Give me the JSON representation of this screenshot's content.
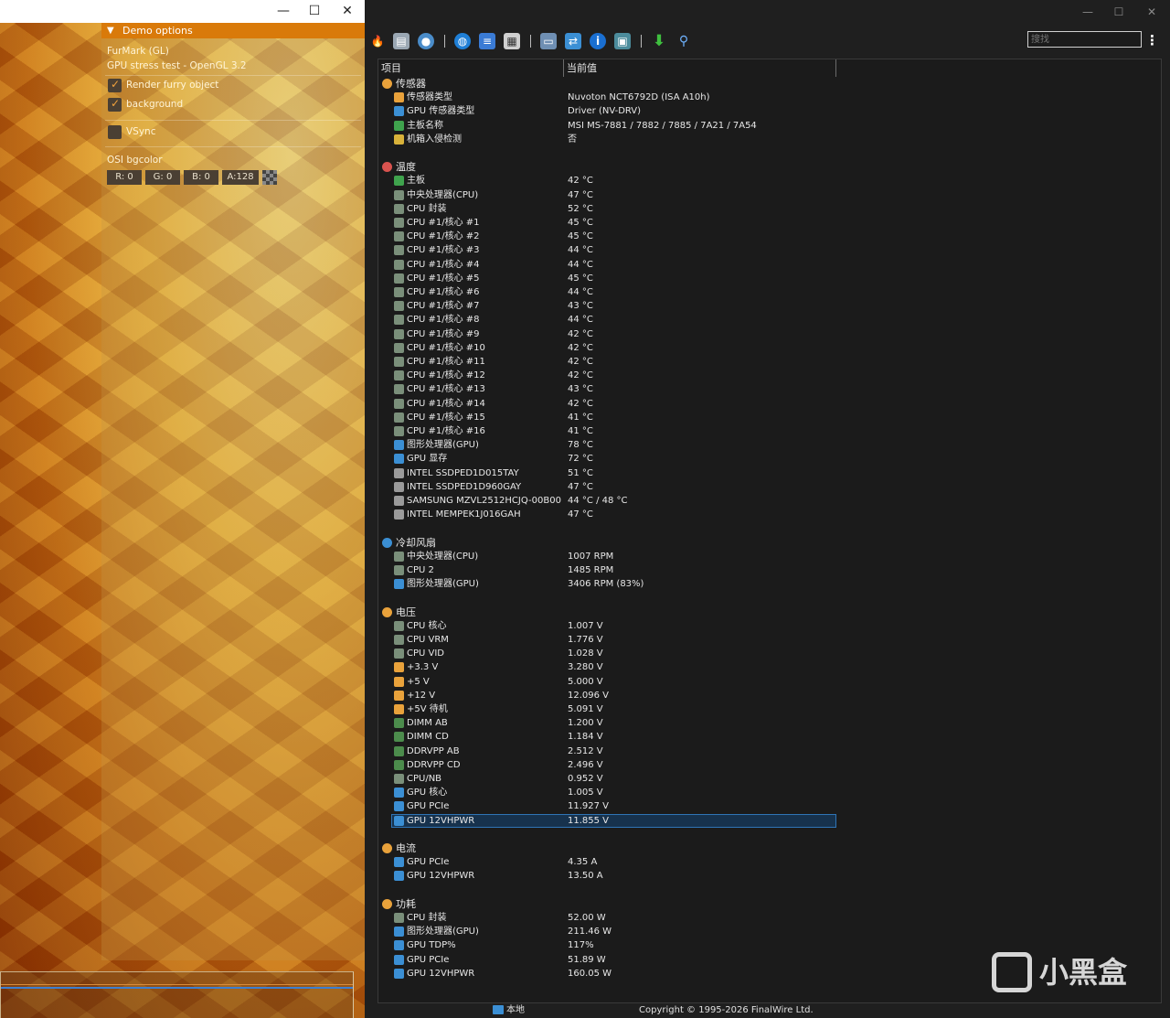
{
  "furmark": {
    "window_controls": [
      "—",
      "☐",
      "✕"
    ],
    "panel_title": "Demo options",
    "app_name": "FurMark (GL)",
    "subtitle": "GPU stress test - OpenGL 3.2",
    "options": [
      {
        "label": "Render furry object",
        "checked": true
      },
      {
        "label": "background",
        "checked": true
      },
      {
        "label": "VSync",
        "checked": false
      }
    ],
    "osi_label": "OSI bgcolor",
    "rgba": [
      "R: 0",
      "G: 0",
      "B: 0",
      "A:128"
    ]
  },
  "aida": {
    "window_controls": [
      "—",
      "☐",
      "✕"
    ],
    "toolbar_icons": [
      "flame-icon",
      "report-icon",
      "user-icon",
      "globe-icon",
      "database-icon",
      "calendar-icon",
      "monitor-icon",
      "network-icon",
      "info-icon",
      "board-icon",
      "download-icon",
      "search-icon"
    ],
    "search_placeholder": "搜找",
    "columns": {
      "item": "项目",
      "value": "当前值"
    },
    "rows": [
      {
        "section": true,
        "label": "传感器",
        "color": "#e9a23b"
      },
      {
        "label": "传感器类型",
        "value": "Nuvoton NCT6792D  (ISA A10h)",
        "color": "#e9a23b"
      },
      {
        "label": "GPU 传感器类型",
        "value": "Driver  (NV-DRV)",
        "color": "#3b8fd4"
      },
      {
        "label": "主板名称",
        "value": "MSI MS-7881 / 7882 / 7885 / 7A21 / 7A54",
        "color": "#3fa34d"
      },
      {
        "label": "机箱入侵检测",
        "value": "否",
        "color": "#d9b23a"
      },
      {
        "blank": true
      },
      {
        "section": true,
        "label": "温度",
        "color": "#d9534f"
      },
      {
        "label": "主板",
        "value": "42 °C",
        "color": "#3fa34d"
      },
      {
        "label": "中央处理器(CPU)",
        "value": "47 °C",
        "color": "#7a8f7a"
      },
      {
        "label": "CPU 封装",
        "value": "52 °C",
        "color": "#7a8f7a"
      },
      {
        "label": "CPU #1/核心 #1",
        "value": "45 °C",
        "color": "#7a8f7a"
      },
      {
        "label": "CPU #1/核心 #2",
        "value": "45 °C",
        "color": "#7a8f7a"
      },
      {
        "label": "CPU #1/核心 #3",
        "value": "44 °C",
        "color": "#7a8f7a"
      },
      {
        "label": "CPU #1/核心 #4",
        "value": "44 °C",
        "color": "#7a8f7a"
      },
      {
        "label": "CPU #1/核心 #5",
        "value": "45 °C",
        "color": "#7a8f7a"
      },
      {
        "label": "CPU #1/核心 #6",
        "value": "44 °C",
        "color": "#7a8f7a"
      },
      {
        "label": "CPU #1/核心 #7",
        "value": "43 °C",
        "color": "#7a8f7a"
      },
      {
        "label": "CPU #1/核心 #8",
        "value": "44 °C",
        "color": "#7a8f7a"
      },
      {
        "label": "CPU #1/核心 #9",
        "value": "42 °C",
        "color": "#7a8f7a"
      },
      {
        "label": "CPU #1/核心 #10",
        "value": "42 °C",
        "color": "#7a8f7a"
      },
      {
        "label": "CPU #1/核心 #11",
        "value": "42 °C",
        "color": "#7a8f7a"
      },
      {
        "label": "CPU #1/核心 #12",
        "value": "42 °C",
        "color": "#7a8f7a"
      },
      {
        "label": "CPU #1/核心 #13",
        "value": "43 °C",
        "color": "#7a8f7a"
      },
      {
        "label": "CPU #1/核心 #14",
        "value": "42 °C",
        "color": "#7a8f7a"
      },
      {
        "label": "CPU #1/核心 #15",
        "value": "41 °C",
        "color": "#7a8f7a"
      },
      {
        "label": "CPU #1/核心 #16",
        "value": "41 °C",
        "color": "#7a8f7a"
      },
      {
        "label": "图形处理器(GPU)",
        "value": "78 °C",
        "color": "#3b8fd4"
      },
      {
        "label": "GPU 显存",
        "value": "72 °C",
        "color": "#3b8fd4"
      },
      {
        "label": "INTEL SSDPED1D015TAY",
        "value": "51 °C",
        "color": "#9a9a9a"
      },
      {
        "label": "INTEL SSDPED1D960GAY",
        "value": "47 °C",
        "color": "#9a9a9a"
      },
      {
        "label": "SAMSUNG MZVL2512HCJQ-00B00",
        "value": "44 °C / 48 °C",
        "color": "#9a9a9a"
      },
      {
        "label": "INTEL MEMPEK1J016GAH",
        "value": "47 °C",
        "color": "#9a9a9a"
      },
      {
        "blank": true
      },
      {
        "section": true,
        "label": "冷却风扇",
        "color": "#3b8fd4"
      },
      {
        "label": "中央处理器(CPU)",
        "value": "1007 RPM",
        "color": "#7a8f7a"
      },
      {
        "label": "CPU 2",
        "value": "1485 RPM",
        "color": "#7a8f7a"
      },
      {
        "label": "图形处理器(GPU)",
        "value": "3406 RPM  (83%)",
        "color": "#3b8fd4"
      },
      {
        "blank": true
      },
      {
        "section": true,
        "label": "电压",
        "color": "#e9a23b"
      },
      {
        "label": "CPU 核心",
        "value": "1.007 V",
        "color": "#7a8f7a"
      },
      {
        "label": "CPU VRM",
        "value": "1.776 V",
        "color": "#7a8f7a"
      },
      {
        "label": "CPU VID",
        "value": "1.028 V",
        "color": "#7a8f7a"
      },
      {
        "label": "+3.3 V",
        "value": "3.280 V",
        "color": "#e9a23b"
      },
      {
        "label": "+5 V",
        "value": "5.000 V",
        "color": "#e9a23b"
      },
      {
        "label": "+12 V",
        "value": "12.096 V",
        "color": "#e9a23b"
      },
      {
        "label": "+5V 待机",
        "value": "5.091 V",
        "color": "#e9a23b"
      },
      {
        "label": "DIMM AB",
        "value": "1.200 V",
        "color": "#4c8c4c"
      },
      {
        "label": "DIMM CD",
        "value": "1.184 V",
        "color": "#4c8c4c"
      },
      {
        "label": "DDRVPP AB",
        "value": "2.512 V",
        "color": "#4c8c4c"
      },
      {
        "label": "DDRVPP CD",
        "value": "2.496 V",
        "color": "#4c8c4c"
      },
      {
        "label": "CPU/NB",
        "value": "0.952 V",
        "color": "#7a8f7a"
      },
      {
        "label": "GPU 核心",
        "value": "1.005 V",
        "color": "#3b8fd4"
      },
      {
        "label": "GPU PCIe",
        "value": "11.927 V",
        "color": "#3b8fd4"
      },
      {
        "label": "GPU 12VHPWR",
        "value": "11.855 V",
        "color": "#3b8fd4",
        "selected": true
      },
      {
        "blank": true
      },
      {
        "section": true,
        "label": "电流",
        "color": "#e9a23b"
      },
      {
        "label": "GPU PCIe",
        "value": "4.35 A",
        "color": "#3b8fd4"
      },
      {
        "label": "GPU 12VHPWR",
        "value": "13.50 A",
        "color": "#3b8fd4"
      },
      {
        "blank": true
      },
      {
        "section": true,
        "label": "功耗",
        "color": "#e9a23b"
      },
      {
        "label": "CPU 封装",
        "value": "52.00 W",
        "color": "#7a8f7a"
      },
      {
        "label": "图形处理器(GPU)",
        "value": "211.46 W",
        "color": "#3b8fd4"
      },
      {
        "label": "GPU TDP%",
        "value": "117%",
        "color": "#3b8fd4"
      },
      {
        "label": "GPU PCIe",
        "value": "51.89 W",
        "color": "#3b8fd4"
      },
      {
        "label": "GPU 12VHPWR",
        "value": "160.05 W",
        "color": "#3b8fd4"
      }
    ],
    "status_left": "本地",
    "status_copyright": "Copyright © 1995-2026 FinalWire Ltd."
  },
  "watermark": {
    "text": "小黑盒"
  }
}
